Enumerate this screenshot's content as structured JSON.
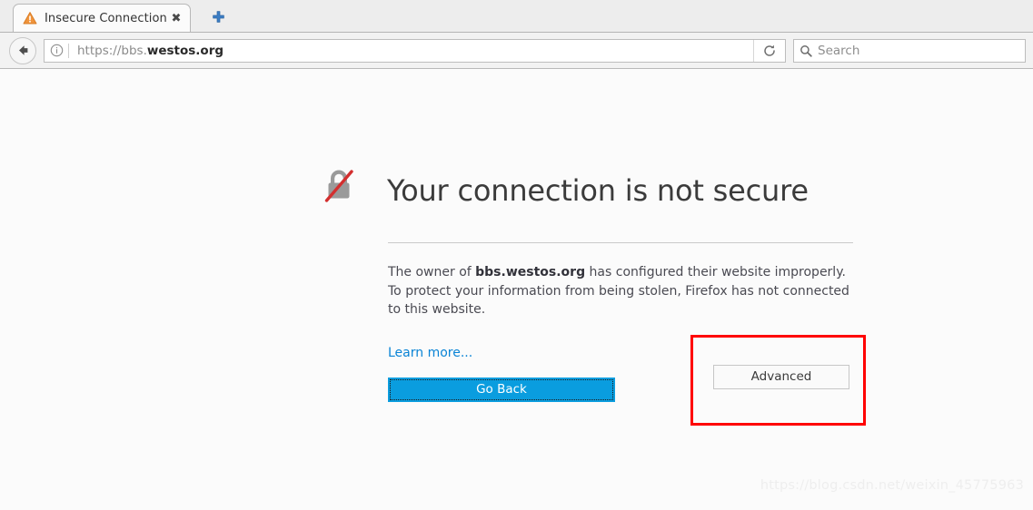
{
  "window": {
    "tab": {
      "favicon": "warning-triangle-icon",
      "title": "Insecure Connection",
      "close_label": "✖"
    },
    "newtab_label": "+",
    "toolbar": {
      "back_icon": "back-arrow-icon",
      "identity_icon": "info-circle-icon",
      "url_prefix": "https://bbs.",
      "url_domain": "westos.org",
      "url_full": "https://bbs.westos.org",
      "reload_icon": "reload-icon",
      "search_icon": "search-icon",
      "search_placeholder": "Search",
      "search_value": ""
    }
  },
  "page": {
    "icon": "broken-lock-icon",
    "title": "Your connection is not secure",
    "body_part1": "The owner of ",
    "body_domain": "bbs.westos.org",
    "body_part2": " has configured their website improperly. To protect your information from being stolen, Firefox has not connected to this website.",
    "learn_more": "Learn more...",
    "go_back_label": "Go Back",
    "advanced_label": "Advanced"
  },
  "annotation": {
    "highlight_color": "#ff0000",
    "target": "advanced-button"
  },
  "watermark": {
    "text": "https://blog.csdn.net/weixin_45775963"
  },
  "colors": {
    "accent_blue": "#0a9ddf",
    "link_blue": "#0a84d6",
    "tabstrip_bg": "#ededed",
    "toolbar_bg": "#f2f2f2",
    "content_bg": "#fbfbfb",
    "lock_gray": "#9a9a9a",
    "slash_red": "#d32f2f"
  }
}
